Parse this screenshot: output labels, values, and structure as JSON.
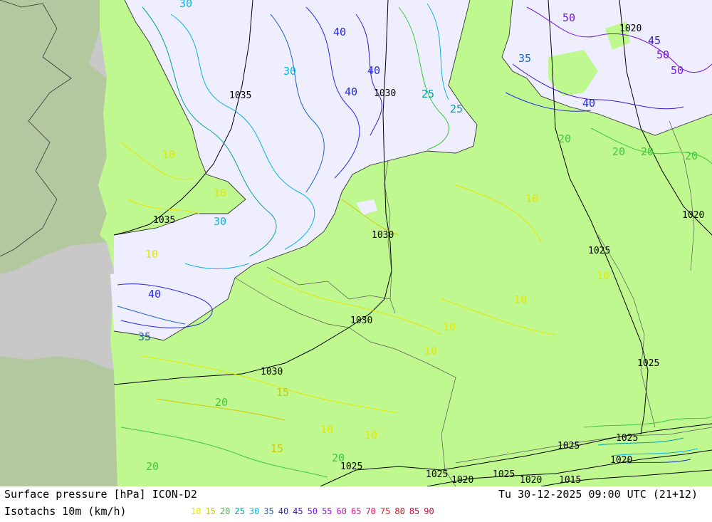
{
  "title": "Surface pressure [hPa] ICON-D2",
  "subtitle": "Isotachs 10m (km/h)",
  "valid_time": "Tu 30-12-2025 09:00 UTC (21+12)",
  "isotach_scale": [
    {
      "v": "10",
      "c": "#e6e600"
    },
    {
      "v": "15",
      "c": "#d2c800"
    },
    {
      "v": "20",
      "c": "#3cc83c"
    },
    {
      "v": "25",
      "c": "#00a0a0"
    },
    {
      "v": "30",
      "c": "#0ab4e6"
    },
    {
      "v": "35",
      "c": "#1e64c8"
    },
    {
      "v": "40",
      "c": "#2828e6"
    },
    {
      "v": "45",
      "c": "#3c14c8"
    },
    {
      "v": "50",
      "c": "#7814e6"
    },
    {
      "v": "55",
      "c": "#a014e6"
    },
    {
      "v": "60",
      "c": "#c814c8"
    },
    {
      "v": "65",
      "c": "#e614a0"
    },
    {
      "v": "70",
      "c": "#e61464"
    },
    {
      "v": "75",
      "c": "#e61e1e"
    },
    {
      "v": "80",
      "c": "#c81414"
    },
    {
      "v": "85",
      "c": "#c80a3c"
    },
    {
      "v": "90",
      "c": "#b4143c"
    }
  ],
  "colors": {
    "land_model": "#c0f890",
    "sea_model": "#eeeeff",
    "outside_domain": "#b4c8a0",
    "outside_sea": "#c8c8c8",
    "isobar": "#000000"
  },
  "isobar_labels": [
    "1035",
    "1035",
    "1030",
    "1030",
    "1030",
    "1030",
    "1025",
    "1025",
    "1025",
    "1025",
    "1025",
    "1025",
    "1025",
    "1020",
    "1020",
    "1020",
    "1020",
    "1020",
    "1015"
  ],
  "isotach_labels": [
    "30",
    "40",
    "40",
    "40",
    "30",
    "25",
    "10",
    "10",
    "10",
    "10",
    "20",
    "20",
    "20",
    "20",
    "35",
    "40",
    "50",
    "50",
    "50",
    "45",
    "25",
    "10",
    "10",
    "10",
    "10",
    "20",
    "15",
    "10",
    "10",
    "15",
    "20",
    "40",
    "35",
    "30",
    "20"
  ]
}
